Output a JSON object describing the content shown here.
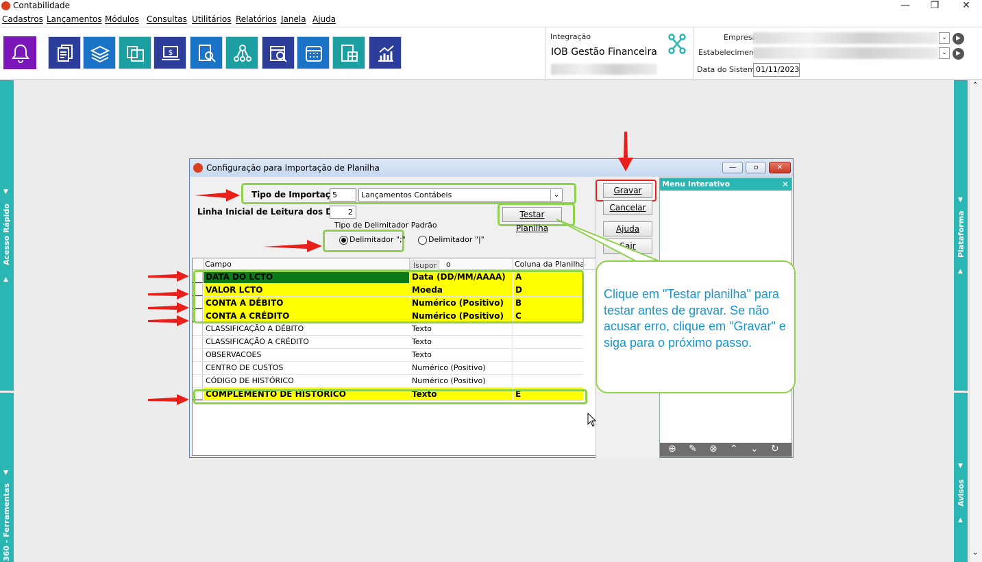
{
  "window": {
    "title": "Contabilidade"
  },
  "menubar": [
    "Cadastros",
    "Lançamentos",
    "Módulos",
    "Consultas",
    "Utilitários",
    "Relatórios",
    "Janela",
    "Ajuda"
  ],
  "integration": {
    "label": "Integração",
    "name": "IOB Gestão Financeira"
  },
  "company": {
    "empresa_label": "Empresa",
    "estabelecimento_label": "Estabelecimento",
    "data_label": "Data do Sistema",
    "data_value": "01/11/2023"
  },
  "sidebar": {
    "left_top": "Acesso Rápido",
    "left_bottom": "360 - Ferramentas",
    "right_top": "Plataforma",
    "right_bottom": "Avisos"
  },
  "dialog": {
    "title": "Configuração para Importação de Planilha",
    "tipo_label": "Tipo de Importação",
    "tipo_code": "5",
    "tipo_value": "Lançamentos Contábeis",
    "linha_label": "Linha Inicial de Leitura dos Dados",
    "linha_value": "2",
    "delim_group": "Tipo de Delimitador Padrão",
    "delim_opt1": "Delimitador \";\"",
    "delim_opt2": "Delimitador \"|\"",
    "testar": "Testar Planilha",
    "buttons": {
      "gravar": "Gravar",
      "cancelar": "Cancelar",
      "ajuda": "Ajuda",
      "sair": "Sair"
    },
    "menu_title": "Menu Interativo",
    "tooltip": "Isupor",
    "grid": {
      "headers": [
        "Campo",
        "Ti",
        "o",
        "Coluna da Planilha"
      ],
      "rows": [
        {
          "campo": "DATA DO LCTO",
          "tipo": "Data (DD/MM/AAAA)",
          "coluna": "A",
          "hl": true
        },
        {
          "campo": "VALOR LCTO",
          "tipo": "Moeda",
          "coluna": "D",
          "hl": true
        },
        {
          "campo": "CONTA A DÉBITO",
          "tipo": "Numérico (Positivo)",
          "coluna": "B",
          "hl": true
        },
        {
          "campo": "CONTA A CRÉDITO",
          "tipo": "Numérico (Positivo)",
          "coluna": "C",
          "hl": true
        },
        {
          "campo": "CLASSIFICAÇÃO A DÉBITO",
          "tipo": "Texto",
          "coluna": ""
        },
        {
          "campo": "CLASSIFICAÇÃO A CRÉDITO",
          "tipo": "Texto",
          "coluna": ""
        },
        {
          "campo": "OBSERVACOES",
          "tipo": "Texto",
          "coluna": ""
        },
        {
          "campo": "CENTRO DE CUSTOS",
          "tipo": "Numérico (Positivo)",
          "coluna": ""
        },
        {
          "campo": "CÓDIGO DE HISTÓRICO",
          "tipo": "Numérico (Positivo)",
          "coluna": ""
        },
        {
          "campo": "COMPLEMENTO DE HISTÓRICO",
          "tipo": "Texto",
          "coluna": "E",
          "hl": true
        }
      ]
    }
  },
  "callout": "Clique em \"Testar planilha\" para testar antes de gravar. Se não acusar erro, clique em \"Gravar\" e siga para o próximo passo.",
  "colors": {
    "accent_teal": "#2cb6b3",
    "toolbar_blue": "#2d3e9a",
    "highlight_yellow": "#ffff00",
    "highlight_green": "#8ed24b",
    "arrow_red": "#e8201b"
  }
}
